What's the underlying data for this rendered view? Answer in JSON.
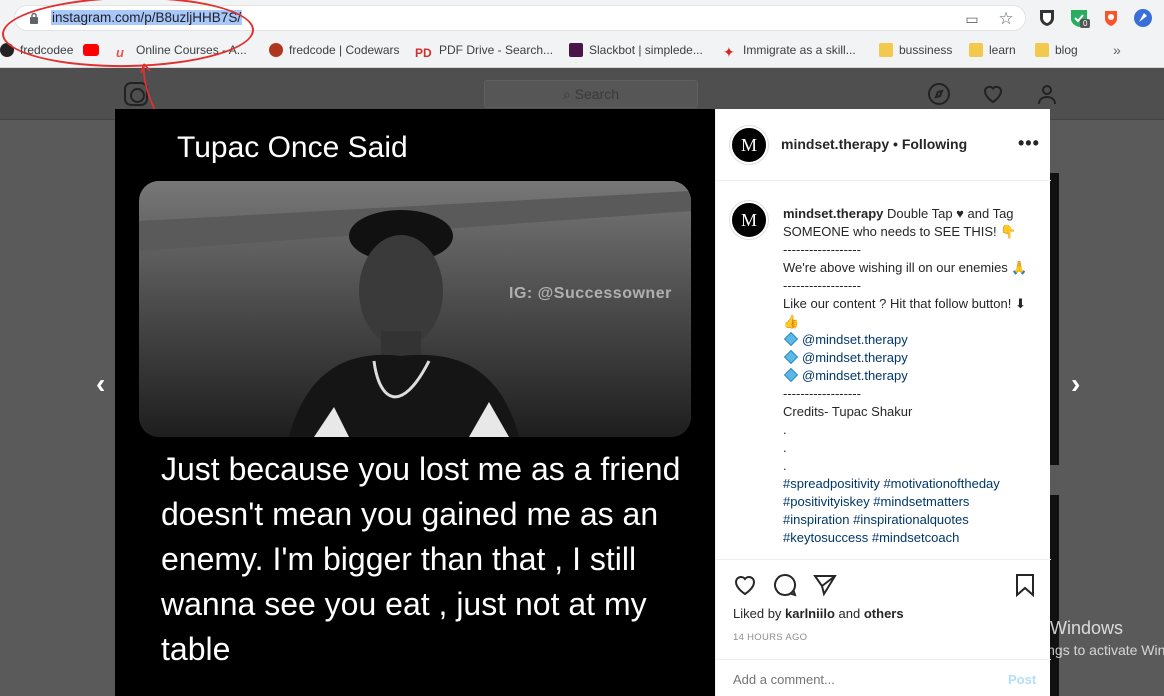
{
  "browser": {
    "url": "instagram.com/p/B8uzljHHB7S/",
    "bookmarks": [
      {
        "label": "fredcodee",
        "color": "#222222"
      },
      {
        "label": "",
        "color": "#ff0000"
      },
      {
        "label": "Online Courses - A...",
        "color": "#ec5252"
      },
      {
        "label": "fredcode | Codewars",
        "color": "#b1361e"
      },
      {
        "label": "PDF Drive - Search...",
        "color": "#d32f2f"
      },
      {
        "label": "Slackbot | simplede...",
        "color": "#4a154b"
      },
      {
        "label": "Immigrate as a skill...",
        "color": "#d52b1e"
      },
      {
        "label": "bussiness",
        "color": "#f2c94c"
      },
      {
        "label": "learn",
        "color": "#f2c94c"
      },
      {
        "label": "blog",
        "color": "#f2c94c"
      }
    ],
    "more": "»",
    "extension_badge": "0"
  },
  "instagram": {
    "search_placeholder": "Search",
    "post": {
      "title": "Tupac Once Said",
      "watermark": "IG: @Successowner",
      "quote": "Just because you lost me as a friend doesn't mean you gained me as an enemy. I'm bigger than that , I still wanna see you eat , just not at my table"
    },
    "panel": {
      "username": "mindset.therapy",
      "separator": "•",
      "follow_status": "Following",
      "avatar_letter": "M",
      "more": "•••",
      "caption": {
        "user": "mindset.therapy",
        "lines": [
          " Double Tap ♥ and Tag SOMEONE who needs to SEE THIS! 👇",
          "------------------",
          "We're above wishing ill on our enemies 🙏",
          "------------------",
          "Like our content ? Hit that follow button! ⬇👍",
          "@mindset.therapy",
          "@mindset.therapy",
          "@mindset.therapy",
          "------------------",
          "Credits- Tupac Shakur",
          ".",
          ".",
          ".",
          "#spreadpositivity #motivationoftheday",
          "#positivityiskey #mindsetmatters",
          "#inspiration #inspirationalquotes",
          "#keytosuccess #mindsetcoach"
        ]
      },
      "likes_prefix": "Liked by",
      "likes_user": "karlniilo",
      "likes_and": "and",
      "likes_others": "others",
      "time": "14 HOURS AGO",
      "comment_placeholder": "Add a comment...",
      "post_button": "Post"
    }
  },
  "nav": {
    "prev": "‹",
    "next": "›"
  },
  "windows_watermark": {
    "line1": "Activate Windows",
    "line2": "Go to Settings to activate Windows."
  }
}
